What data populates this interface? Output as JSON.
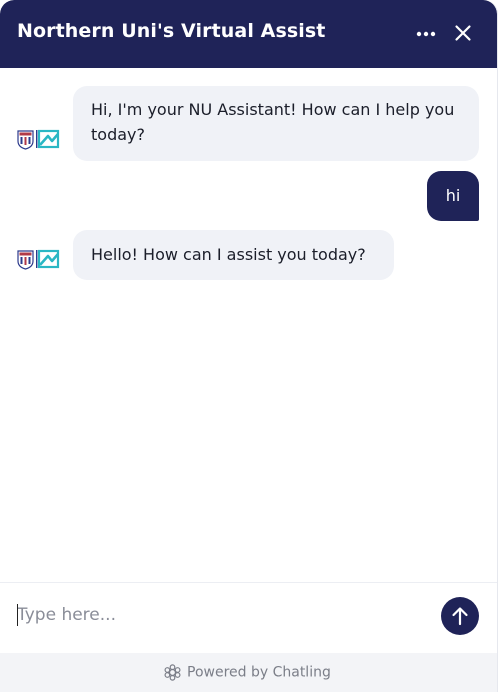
{
  "header": {
    "title": "Northern Uni's Virtual Assist",
    "more_icon": "more-horizontal-icon",
    "close_icon": "close-icon",
    "background_color": "#1f2358"
  },
  "messages": [
    {
      "sender": "bot",
      "text": "Hi, I'm your NU Assistant! How can I help you today?",
      "avatar": "nu-assistant-avatar"
    },
    {
      "sender": "user",
      "text": "hi"
    },
    {
      "sender": "bot",
      "text": "Hello! How can I assist you today?",
      "avatar": "nu-assistant-avatar"
    }
  ],
  "composer": {
    "placeholder": "Type here...",
    "value": "",
    "send_icon": "arrow-up-icon"
  },
  "footer": {
    "text": "Powered by Chatling",
    "icon": "chatling-logo-icon"
  },
  "colors": {
    "accent": "#1f2358",
    "bot_bubble": "#f0f2f7",
    "avatar_teal": "#2ab7c4"
  }
}
